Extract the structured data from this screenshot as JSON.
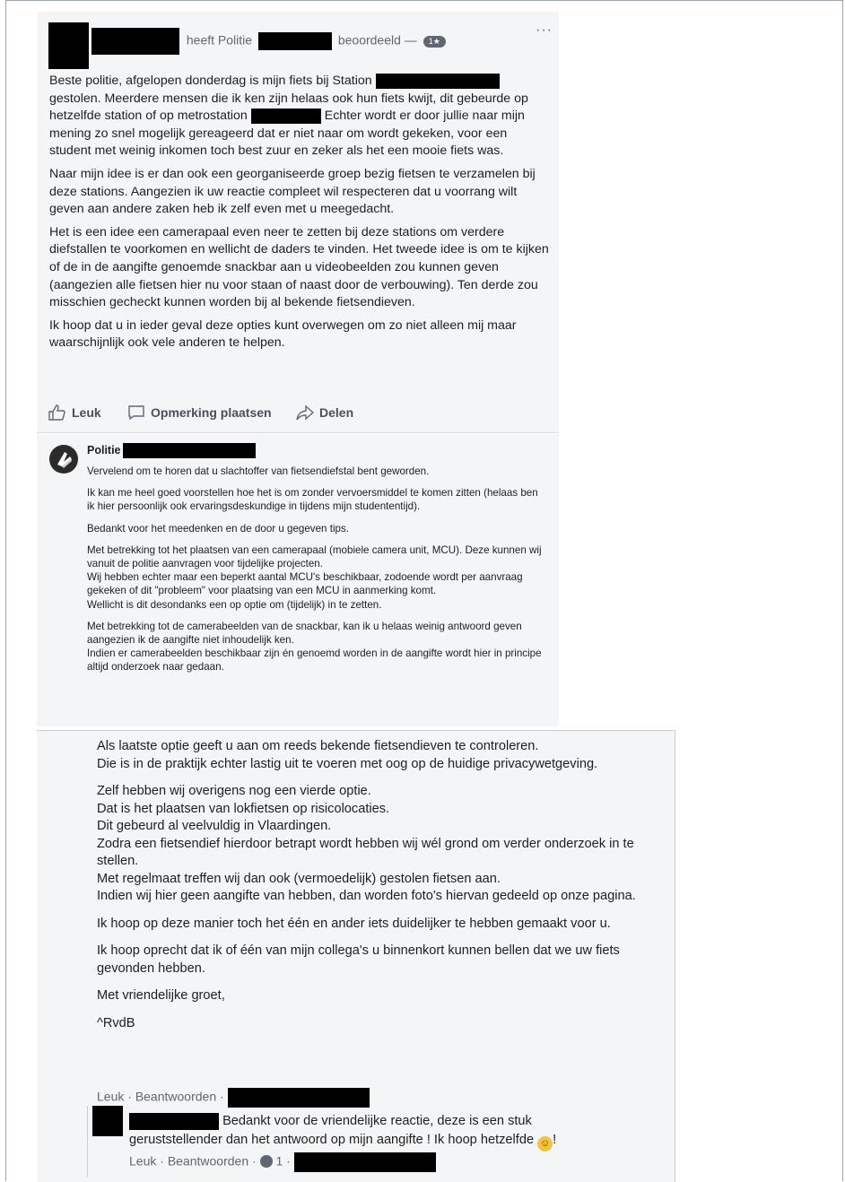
{
  "post": {
    "heading_pre": "heeft Politie",
    "heading_post": "beoordeeld —",
    "rating_badge": "1★",
    "more_label": "···",
    "paragraphs": [
      "Beste politie, afgelopen donderdag is mijn fiets bij Station",
      "gestolen. Meerdere mensen die ik ken zijn helaas ook hun fiets kwijt, dit gebeurde op hetzelfde station of op metrostation",
      "Echter wordt er door jullie naar mijn mening zo snel mogelijk gereageerd dat er niet naar om wordt gekeken, voor een student met weinig inkomen toch best zuur en zeker als het een mooie fiets was.",
      "Naar mijn idee is er dan ook een georganiseerde groep bezig fietsen te verzamelen bij deze stations. Aangezien ik uw reactie compleet wil respecteren dat u voorrang wilt geven aan andere zaken heb ik zelf even met u meegedacht.",
      "Het is een idee een camerapaal even neer te zetten bij deze stations om verdere diefstallen te voorkomen en wellicht de daders te vinden. Het tweede idee is om te kijken of de in de aangifte genoemde snackbar aan u videobeelden zou kunnen geven (aangezien alle fietsen hier nu voor staan of naast door de verbouwing). Ten derde zou misschien gecheckt kunnen worden bij al bekende fietsendieven.",
      "Ik hoop dat u in ieder geval deze opties kunt overwegen om zo niet alleen mij maar waarschijnlijk ook vele anderen te helpen."
    ],
    "actions": {
      "like": "Leuk",
      "comment": "Opmerking plaatsen",
      "share": "Delen"
    }
  },
  "reply": {
    "author": "Politie",
    "paragraphs": [
      "Vervelend om te horen dat u slachtoffer van fietsendiefstal bent geworden.",
      "Ik kan me heel goed voorstellen hoe het is om zonder vervoersmiddel te komen zitten (helaas ben ik hier persoonlijk ook ervaringsdeskundige in tijdens mijn studententijd).",
      "Bedankt voor het meedenken en de door u gegeven tips.",
      "Met betrekking tot het plaatsen van een camerapaal (mobiele camera unit, MCU). Deze kunnen wij vanuit de politie aanvragen voor tijdelijke projecten.\nWij hebben echter maar een beperkt aantal MCU's beschikbaar, zodoende wordt per aanvraag gekeken of dit \"probleem\" voor plaatsing van een MCU in aanmerking komt.\nWellicht is dit desondanks een op optie om (tijdelijk) in te zetten.",
      "Met betrekking tot de camerabeelden van de snackbar, kan ik u helaas weinig antwoord geven aangezien ik de aangifte niet inhoudelijk ken.\nIndien er camerabeelden beschikbaar zijn én genoemd worden in de aangifte wordt hier in principe altijd onderzoek naar gedaan."
    ]
  },
  "continuation": {
    "paragraphs": [
      "Als laatste optie geeft u aan om reeds bekende fietsendieven te controleren.\nDie is in de praktijk echter lastig uit te voeren met oog op de huidige privacywetgeving.",
      "Zelf hebben wij overigens nog een vierde optie.\nDat is het plaatsen van lokfietsen op risicolocaties.\nDit gebeurd al veelvuldig in Vlaardingen.\nZodra een fietsendief hierdoor betrapt wordt hebben wij wél grond om verder onderzoek in te stellen.\nMet regelmaat treffen wij dan ook (vermoedelijk) gestolen fietsen aan.\nIndien wij hier geen aangifte van hebben, dan worden foto's hiervan gedeeld op onze pagina.",
      "Ik hoop op deze manier toch het één en ander iets duidelijker te hebben gemaakt voor u.",
      "Ik hoop oprecht dat ik of één van mijn collega's u binnenkort kunnen bellen dat we uw fiets gevonden hebben.",
      "Met vriendelijke groet,",
      "^RvdB"
    ],
    "meta_like": "Leuk",
    "meta_reply": "Beantwoorden",
    "sep": " · "
  },
  "subreply": {
    "text_line1": "Bedankt voor de vriendelijke reactie, deze is een stuk",
    "text_line2": "geruststellender dan het antwoord op mijn aangifte ! Ik hoop hetzelfde",
    "text_end": "!",
    "emoji": "☺",
    "meta_like": "Leuk",
    "meta_reply": "Beantwoorden",
    "reaction_count": "1"
  }
}
